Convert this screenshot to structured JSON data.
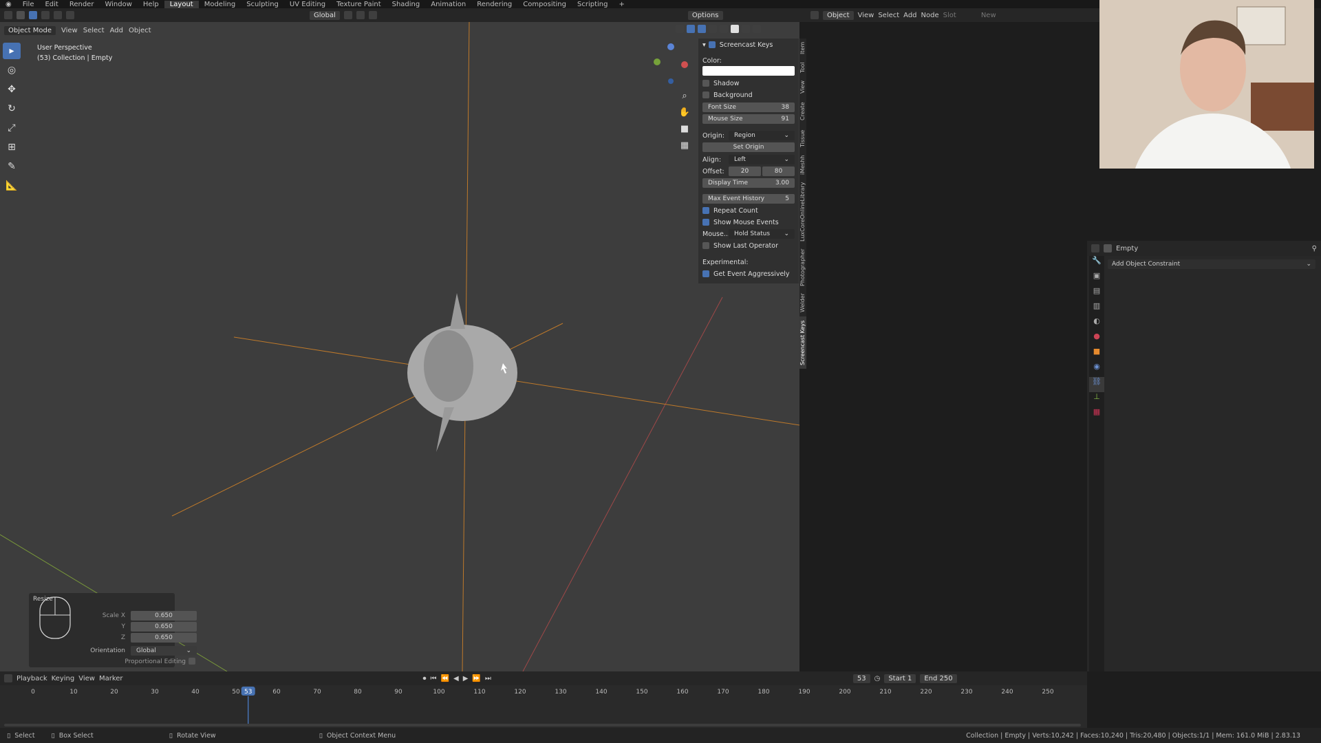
{
  "menu": [
    "File",
    "Edit",
    "Render",
    "Window",
    "Help"
  ],
  "workspaces": [
    "Layout",
    "Modeling",
    "Sculpting",
    "UV Editing",
    "Texture Paint",
    "Shading",
    "Animation",
    "Rendering",
    "Compositing",
    "Scripting"
  ],
  "active_workspace": "Layout",
  "header": {
    "orientation": "Global",
    "options": "Options"
  },
  "viewport": {
    "mode": "Object Mode",
    "menus": [
      "View",
      "Select",
      "Add",
      "Object"
    ],
    "perspective": "User Perspective",
    "collection": "(53) Collection | Empty"
  },
  "npanel": {
    "title": "Screencast Keys",
    "color_label": "Color:",
    "shadow": "Shadow",
    "background": "Background",
    "font_size_label": "Font Size",
    "font_size": "38",
    "mouse_size_label": "Mouse Size",
    "mouse_size": "91",
    "origin_label": "Origin:",
    "origin": "Region",
    "set_origin": "Set Origin",
    "align_label": "Align:",
    "align": "Left",
    "offset_label": "Offset:",
    "offset_x": "20",
    "offset_y": "80",
    "display_time_label": "Display Time",
    "display_time": "3.00",
    "max_history_label": "Max Event History",
    "max_history": "5",
    "repeat_count": "Repeat Count",
    "show_mouse": "Show Mouse Events",
    "mouse_label": "Mouse...",
    "mouse_val": "Hold Status",
    "show_last": "Show Last Operator",
    "experimental": "Experimental:",
    "get_event": "Get Event Aggressively",
    "colors": {
      "accent": "#4772b3"
    }
  },
  "vtabs": [
    "Item",
    "Tool",
    "View",
    "Create",
    "Tissue",
    "iMeshh",
    "LuxCoreOnlineLibrary",
    "Photographer",
    "Welder",
    "Screencast Keys"
  ],
  "right_editor": {
    "type": "Object",
    "menus": [
      "View",
      "Select",
      "Add",
      "Node"
    ],
    "slot": "Slot",
    "new": "New"
  },
  "props": {
    "object": "Empty",
    "constraint": "Add Object Constraint"
  },
  "op_panel": {
    "title": "Resize",
    "scale_x_label": "Scale X",
    "scale_x": "0.650",
    "y_label": "Y",
    "y": "0.650",
    "z_label": "Z",
    "z": "0.650",
    "orientation_label": "Orientation",
    "orientation": "Global",
    "prop_label": "Proportional Editing"
  },
  "timeline": {
    "menus": [
      "Playback",
      "Keying",
      "View",
      "Marker"
    ],
    "frame": "53",
    "start_label": "Start",
    "start": "1",
    "end_label": "End",
    "end": "250",
    "ticks": [
      0,
      10,
      20,
      30,
      40,
      50,
      60,
      70,
      80,
      90,
      100,
      110,
      120,
      130,
      140,
      150,
      160,
      170,
      180,
      190,
      200,
      210,
      220,
      230,
      240,
      250
    ],
    "current": 53
  },
  "status": {
    "select": "Select",
    "box_select": "Box Select",
    "rotate_view": "Rotate View",
    "context_menu": "Object Context Menu",
    "stats": "Collection | Empty | Verts:10,242 | Faces:10,240 | Tris:20,480 | Objects:1/1 | Mem: 161.0 MiB | 2.83.13"
  }
}
